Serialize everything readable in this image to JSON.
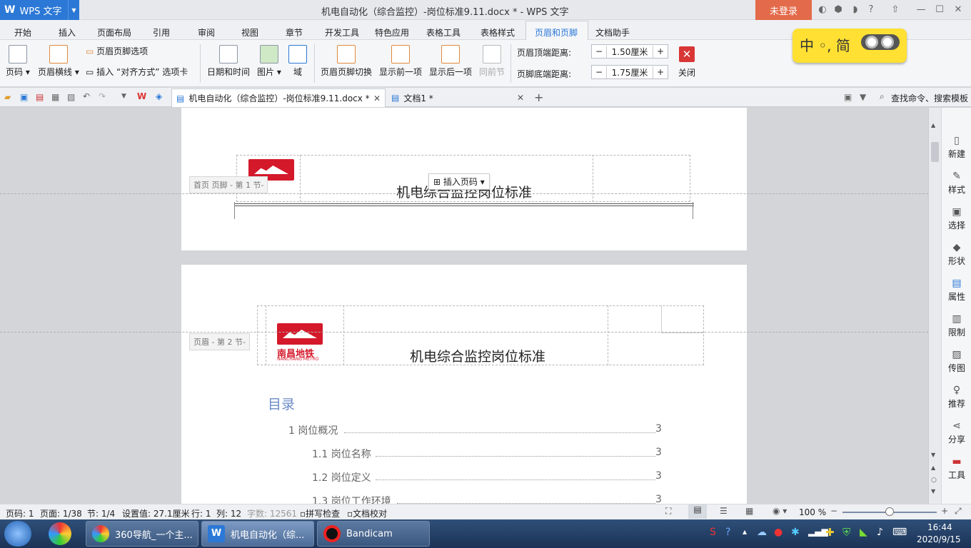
{
  "app": {
    "name": "WPS 文字",
    "logo": "W",
    "login": "未登录"
  },
  "window": {
    "title": "机电自动化（综合监控）-岗位标准9.11.docx * - WPS 文字"
  },
  "menu": [
    "开始",
    "插入",
    "页面布局",
    "引用",
    "审阅",
    "视图",
    "章节",
    "开发工具",
    "特色应用",
    "表格工具",
    "表格样式",
    "页眉和页脚",
    "文档助手"
  ],
  "ribbon": {
    "page_num": "页码",
    "header_line": "页眉横线",
    "hf_options": "页眉页脚选项",
    "insert_align": "插入 “对齐方式” 选项卡",
    "datetime": "日期和时间",
    "picture": "图片",
    "field": "域",
    "hf_switch": "页眉页脚切换",
    "show_prev": "显示前一项",
    "show_next": "显示后一项",
    "same_prev": "同前节",
    "header_top_label": "页眉顶端距离:",
    "header_top_value": "1.50厘米",
    "footer_bottom_label": "页脚底端距离:",
    "footer_bottom_value": "1.75厘米",
    "close": "关闭"
  },
  "ime": {
    "text": "中 ◦, 简"
  },
  "tabs": [
    {
      "label": "机电自动化（综合监控）-岗位标准9.11.docx *"
    },
    {
      "label": "文档1 *"
    }
  ],
  "search": {
    "label": "查找命令、搜索模板"
  },
  "page1": {
    "header_label": "首页 页脚  - 第 1 节-",
    "title": "机电综合监控岗位标准",
    "popup": "插入页码"
  },
  "page2": {
    "header_label": "页眉  - 第 2 节-",
    "logo_cn": "南昌地铁",
    "logo_en": "NANCHANG METRO",
    "title": "机电综合监控岗位标准",
    "toc_title": "目录",
    "toc": [
      {
        "text": "1 岗位概况",
        "page": "3"
      },
      {
        "text": "1.1 岗位名称",
        "page": "3"
      },
      {
        "text": "1.2 岗位定义",
        "page": "3"
      },
      {
        "text": "1.3 岗位工作环境",
        "page": "3"
      }
    ]
  },
  "side": [
    "新建",
    "样式",
    "选择",
    "形状",
    "属性",
    "限制",
    "传图",
    "推荐",
    "分享",
    "工具"
  ],
  "status": {
    "page": "页码: 1",
    "pages": "页面: 1/38",
    "section": "节: 1/4",
    "setting": "设置值: 27.1厘米",
    "row": "行: 1",
    "col": "列: 12",
    "words": "字数: 12561",
    "spell": "拼写检查",
    "proof": "文档校对",
    "zoom": "100 %"
  },
  "taskbar": {
    "items": [
      "360导航_一个主...",
      "机电自动化（综...",
      "Bandicam"
    ],
    "time": "16:44",
    "date": "2020/9/15"
  }
}
